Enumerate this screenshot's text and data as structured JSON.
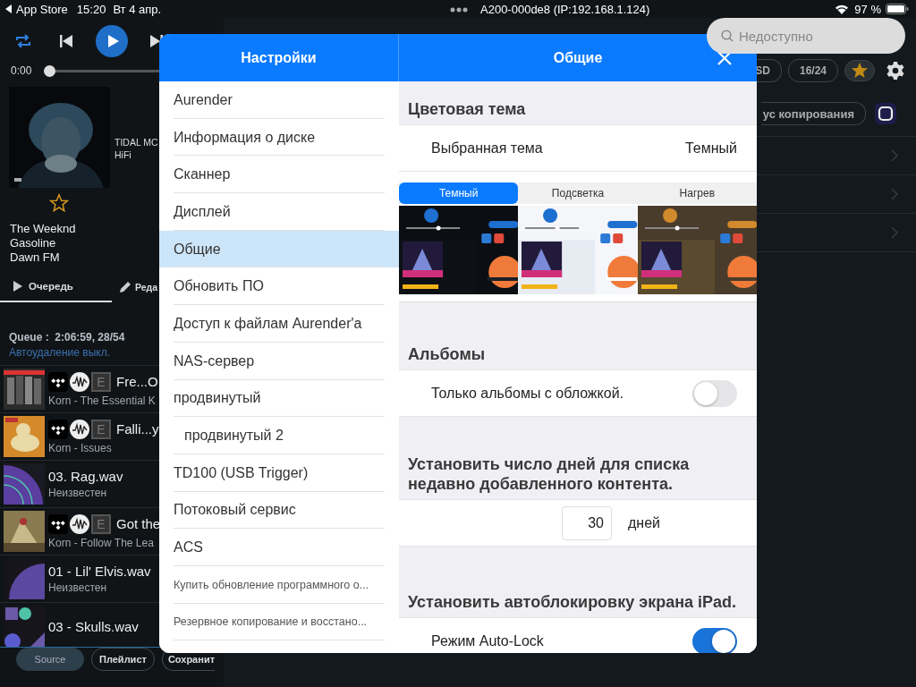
{
  "status_bar": {
    "back_label": "App Store",
    "time": "15:20",
    "date": "Вт 4 апр.",
    "device": "A200-000de8 (IP:192.168.1.124)",
    "battery": "97 %"
  },
  "player": {
    "time": "0:00",
    "level": 0
  },
  "now_playing": {
    "source": "TIDAL MC",
    "quality": "HiFi",
    "favorite": false,
    "artist": "The Weeknd",
    "title": "Gasoline",
    "album": "Dawn FM"
  },
  "panel_tabs": [
    {
      "label": "Очередь",
      "kind": "play",
      "selected": true
    },
    {
      "label": "Реда",
      "kind": "edit",
      "selected": false
    }
  ],
  "queue": {
    "summary": "Queue :  2:06:59, 28/54",
    "auto_delete": "Автоудаление выкл."
  },
  "tracks": [
    {
      "kind": "tidal",
      "explicit": "E",
      "title": "Fre...O",
      "subtitle": "Korn - The Essential K"
    },
    {
      "kind": "tidal",
      "explicit": "E",
      "title": "Falli...y",
      "subtitle": "Korn - Issues"
    },
    {
      "kind": "local",
      "title": "03. Rag.wav",
      "subtitle": "Неизвестен"
    },
    {
      "kind": "tidal",
      "explicit": "E",
      "title": "Got the",
      "subtitle": "Korn - Follow The Lea"
    },
    {
      "kind": "local",
      "title": "01 - Lil' Elvis.wav",
      "subtitle": "Неизвестен"
    },
    {
      "kind": "local",
      "title": "03 - Skulls.wav"
    }
  ],
  "bottom_buttons": [
    {
      "label": "Source",
      "selected": true
    },
    {
      "label": "Плейлист",
      "selected": false
    },
    {
      "label": "Сохранит",
      "selected": false
    }
  ],
  "search": {
    "placeholder": "Недоступно"
  },
  "filters": [
    "SD",
    "16/24"
  ],
  "copy_status": "ус копирования",
  "settings": {
    "title": "Настройки",
    "items": [
      {
        "label": "Aurender",
        "selected": false
      },
      {
        "label": "Информация о диске",
        "selected": false
      },
      {
        "label": "Сканнер",
        "selected": false
      },
      {
        "label": "Дисплей",
        "selected": false
      },
      {
        "label": "Общие",
        "selected": true
      },
      {
        "label": "Обновить ПО",
        "selected": false
      },
      {
        "label": "Доступ к файлам Aurender'а",
        "selected": false
      },
      {
        "label": "NAS-сервер",
        "selected": false
      },
      {
        "label": "продвинутый",
        "selected": false,
        "children": [
          {
            "label": "продвинутый 2",
            "selected": false
          }
        ]
      },
      {
        "label": "TD100 (USB Trigger)",
        "selected": false
      },
      {
        "label": "Потоковый сервис",
        "selected": false
      },
      {
        "label": "ACS",
        "selected": false
      },
      {
        "label": "Купить обновление программного о...",
        "kind": "compact",
        "selected": false
      },
      {
        "label": "Резервное копирование и восстано...",
        "kind": "compact",
        "selected": false
      }
    ]
  },
  "general": {
    "title": "Общие",
    "sections": [
      {
        "kind": "theme",
        "header": "Цветовая тема",
        "label": "Выбранная тема",
        "value": "Темный",
        "segments": [
          {
            "label": "Темный",
            "selected": true
          },
          {
            "label": "Подсветка",
            "selected": false
          },
          {
            "label": "Нагрев",
            "selected": false
          }
        ]
      },
      {
        "kind": "toggle",
        "header": "Альбомы",
        "label": "Только альбомы с обложкой.",
        "on": false
      },
      {
        "kind": "number",
        "header": "Установить число дней для списка недавно добавленного контента.",
        "value": "30",
        "unit": "дней"
      },
      {
        "kind": "toggle",
        "header": "Установить автоблокировку экрана iPad.",
        "label": "Режим Auto-Lock",
        "on": true
      }
    ]
  }
}
